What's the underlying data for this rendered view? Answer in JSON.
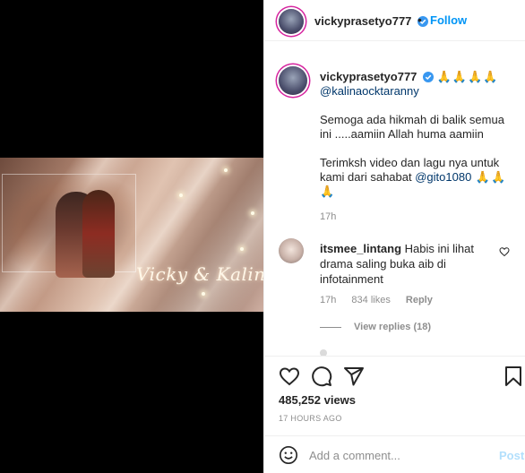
{
  "post": {
    "username": "vickyprasetyo777",
    "follow_separator": "•",
    "follow_label": "Follow",
    "video_overlay_text": "Vicky & Kalina"
  },
  "caption": {
    "username": "vickyprasetyo777",
    "emoji_line": "🙏🙏🙏🙏",
    "mention": "@kalinaocktaranny",
    "paragraph1": "Semoga ada hikmah di balik semua ini .....aamiin Allah huma aamiin",
    "paragraph2_text": "Terimksh video dan lagu nya untuk kami dari sahabat ",
    "paragraph2_mention": "@gito1080",
    "paragraph2_emoji": " 🙏🙏🙏",
    "time": "17h"
  },
  "comment": {
    "username": "itsmee_lintang",
    "text": "Habis ini lihat drama saling buka aib di infotainment",
    "time": "17h",
    "likes": "834 likes",
    "reply_label": "Reply",
    "view_replies": "View replies (18)"
  },
  "stats": {
    "views": "485,252 views",
    "timestamp": "17 HOURS AGO"
  },
  "add_comment": {
    "placeholder": "Add a comment...",
    "post_label": "Post"
  },
  "colors": {
    "link_blue": "#0095f6",
    "handle_blue": "#00376b",
    "muted": "#8e8e8e",
    "post_disabled": "#b2dffc"
  },
  "icons": [
    "heart-icon",
    "comment-icon",
    "share-icon",
    "bookmark-icon",
    "smile-icon",
    "verified-badge-icon"
  ]
}
